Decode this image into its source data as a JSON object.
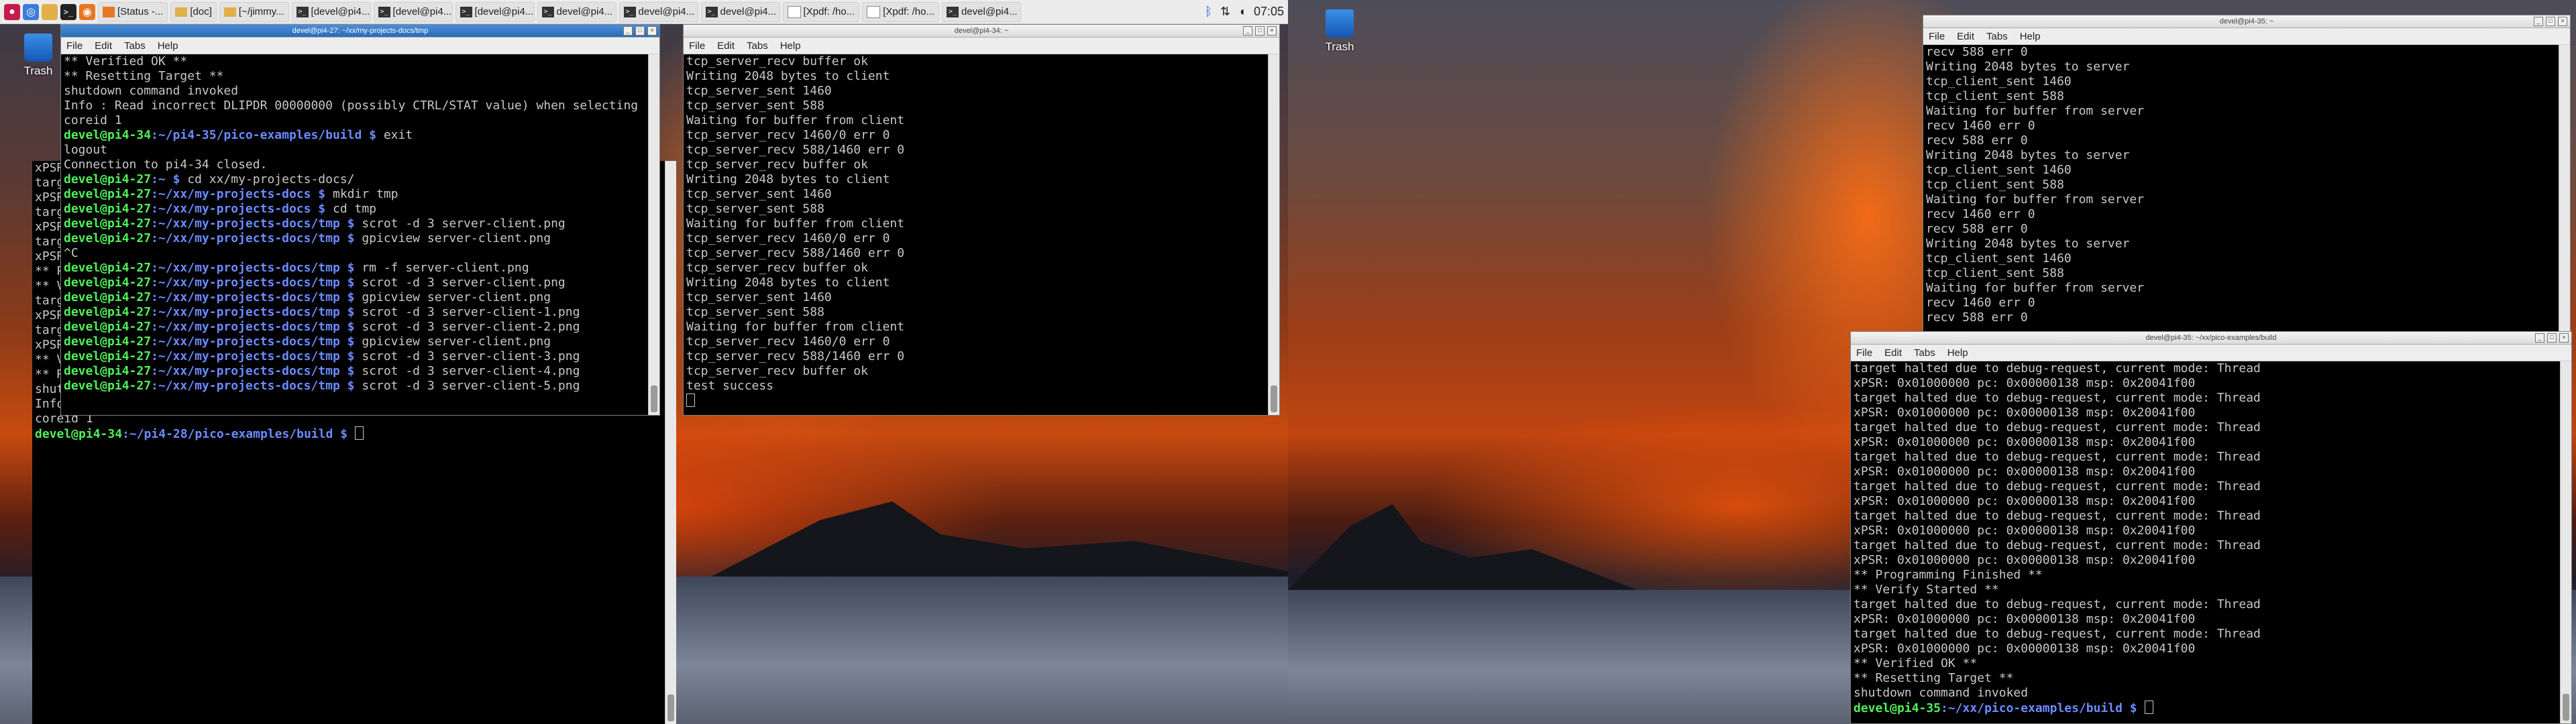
{
  "taskbar": {
    "buttons": [
      {
        "label": "[Status -...",
        "kind": "browser"
      },
      {
        "label": "[doc]",
        "kind": "folder"
      },
      {
        "label": "[~/jimmy...",
        "kind": "folder"
      },
      {
        "label": "[devel@pi4...",
        "kind": "terminal"
      },
      {
        "label": "[devel@pi4...",
        "kind": "terminal"
      },
      {
        "label": "[devel@pi4...",
        "kind": "terminal"
      },
      {
        "label": "devel@pi4...",
        "kind": "terminal"
      },
      {
        "label": "devel@pi4...",
        "kind": "terminal"
      },
      {
        "label": "devel@pi4...",
        "kind": "terminal"
      },
      {
        "label": "[Xpdf: /ho...",
        "kind": "pdf"
      },
      {
        "label": "[Xpdf: /ho...",
        "kind": "pdf"
      },
      {
        "label": "devel@pi4...",
        "kind": "terminal"
      }
    ],
    "clock": "07:05",
    "tray_icons": [
      "bluetooth-icon",
      "network-icon",
      "volume-icon"
    ]
  },
  "desktop": {
    "trash_label": "Trash"
  },
  "menu": {
    "file": "File",
    "edit": "Edit",
    "tabs": "Tabs",
    "help": "Help"
  },
  "windows": {
    "w1": {
      "title": "devel@pi4-27: ~/xx/my-projects-docs/tmp",
      "lines": [
        {
          "t": "** Verified OK **"
        },
        {
          "t": "** Resetting Target **"
        },
        {
          "t": "shutdown command invoked"
        },
        {
          "t": "Info : Read incorrect DLIPDR 00000000 (possibly CTRL/STAT value) when selecting"
        },
        {
          "t": "coreid 1"
        },
        {
          "u": "devel@pi4-34",
          "p": ":~/pi4-35/pico-examples/build $",
          "c": " exit"
        },
        {
          "t": "logout"
        },
        {
          "t": "Connection to pi4-34 closed."
        },
        {
          "u": "devel@pi4-27",
          "p": ":~ $",
          "c": " cd xx/my-projects-docs/"
        },
        {
          "u": "devel@pi4-27",
          "p": ":~/xx/my-projects-docs $",
          "c": " mkdir tmp"
        },
        {
          "u": "devel@pi4-27",
          "p": ":~/xx/my-projects-docs $",
          "c": " cd tmp"
        },
        {
          "u": "devel@pi4-27",
          "p": ":~/xx/my-projects-docs/tmp $",
          "c": " scrot -d 3 server-client.png"
        },
        {
          "u": "devel@pi4-27",
          "p": ":~/xx/my-projects-docs/tmp $",
          "c": " gpicview server-client.png"
        },
        {
          "t": "^C"
        },
        {
          "u": "devel@pi4-27",
          "p": ":~/xx/my-projects-docs/tmp $",
          "c": " rm -f server-client.png"
        },
        {
          "u": "devel@pi4-27",
          "p": ":~/xx/my-projects-docs/tmp $",
          "c": " scrot -d 3 server-client.png"
        },
        {
          "u": "devel@pi4-27",
          "p": ":~/xx/my-projects-docs/tmp $",
          "c": " gpicview server-client.png"
        },
        {
          "u": "devel@pi4-27",
          "p": ":~/xx/my-projects-docs/tmp $",
          "c": " scrot -d 3 server-client-1.png"
        },
        {
          "u": "devel@pi4-27",
          "p": ":~/xx/my-projects-docs/tmp $",
          "c": " scrot -d 3 server-client-2.png"
        },
        {
          "u": "devel@pi4-27",
          "p": ":~/xx/my-projects-docs/tmp $",
          "c": " gpicview server-client.png"
        },
        {
          "u": "devel@pi4-27",
          "p": ":~/xx/my-projects-docs/tmp $",
          "c": " scrot -d 3 server-client-3.png"
        },
        {
          "u": "devel@pi4-27",
          "p": ":~/xx/my-projects-docs/tmp $",
          "c": " scrot -d 3 server-client-4.png"
        },
        {
          "u": "devel@pi4-27",
          "p": ":~/xx/my-projects-docs/tmp $",
          "c": " scrot -d 3 server-client-5.png"
        }
      ]
    },
    "w2": {
      "title": "",
      "lines": [
        {
          "t": "xPSR: 0x01000000 pc: 0x00000138 msp: 0x20041f00"
        },
        {
          "t": "target halted due to debug-request, current mode: Thread"
        },
        {
          "t": "xPSR: 0x01000000 pc: 0x00000138 msp: 0x20041f00"
        },
        {
          "t": "target halted due to debug-request, current mode: Thread"
        },
        {
          "t": "xPSR: 0x01000000 pc: 0x00000138 msp: 0x20041f00"
        },
        {
          "t": "target halted due to debug-request, current mode: Thread"
        },
        {
          "t": "xPSR: 0x01000000 pc: 0x00000138 msp: 0x20041f00"
        },
        {
          "t": "** Programming Finished **"
        },
        {
          "t": "** Verify Started **"
        },
        {
          "t": "target halted due to debug-request, current mode: Thread"
        },
        {
          "t": "xPSR: 0x01000000 pc: 0x00000138 msp: 0x20041f00"
        },
        {
          "t": "target halted due to debug-request, current mode: Thread"
        },
        {
          "t": "xPSR: 0x01000000 pc: 0x00000138 msp: 0x20041f00"
        },
        {
          "t": "** Verified OK **"
        },
        {
          "t": "** Resetting Target **"
        },
        {
          "t": "shutdown command invoked"
        },
        {
          "t": "Info : Read incorrect DLIPDR 00000000 (possibly CTRL/STAT value) when selecting"
        },
        {
          "t": "coreid 1"
        },
        {
          "u": "devel@pi4-34",
          "p": ":~/pi4-28/pico-examples/build $",
          "c": " ",
          "cursor": true
        }
      ]
    },
    "w3": {
      "title": "devel@pi4-34: ~",
      "lines": [
        {
          "t": "tcp_server_recv buffer ok"
        },
        {
          "t": "Writing 2048 bytes to client"
        },
        {
          "t": "tcp_server_sent 1460"
        },
        {
          "t": "tcp_server_sent 588"
        },
        {
          "t": "Waiting for buffer from client"
        },
        {
          "t": "tcp_server_recv 1460/0 err 0"
        },
        {
          "t": "tcp_server_recv 588/1460 err 0"
        },
        {
          "t": "tcp_server_recv buffer ok"
        },
        {
          "t": "Writing 2048 bytes to client"
        },
        {
          "t": "tcp_server_sent 1460"
        },
        {
          "t": "tcp_server_sent 588"
        },
        {
          "t": "Waiting for buffer from client"
        },
        {
          "t": "tcp_server_recv 1460/0 err 0"
        },
        {
          "t": "tcp_server_recv 588/1460 err 0"
        },
        {
          "t": "tcp_server_recv buffer ok"
        },
        {
          "t": "Writing 2048 bytes to client"
        },
        {
          "t": "tcp_server_sent 1460"
        },
        {
          "t": "tcp_server_sent 588"
        },
        {
          "t": "Waiting for buffer from client"
        },
        {
          "t": "tcp_server_recv 1460/0 err 0"
        },
        {
          "t": "tcp_server_recv 588/1460 err 0"
        },
        {
          "t": "tcp_server_recv buffer ok"
        },
        {
          "t": "test success"
        },
        {
          "t": "",
          "cursor": true
        }
      ]
    },
    "w4": {
      "title": "devel@pi4-35: ~",
      "lines": [
        {
          "t": "recv 588 err 0"
        },
        {
          "t": "Writing 2048 bytes to server"
        },
        {
          "t": "tcp_client_sent 1460"
        },
        {
          "t": "tcp_client_sent 588"
        },
        {
          "t": "Waiting for buffer from server"
        },
        {
          "t": "recv 1460 err 0"
        },
        {
          "t": "recv 588 err 0"
        },
        {
          "t": "Writing 2048 bytes to server"
        },
        {
          "t": "tcp_client_sent 1460"
        },
        {
          "t": "tcp_client_sent 588"
        },
        {
          "t": "Waiting for buffer from server"
        },
        {
          "t": "recv 1460 err 0"
        },
        {
          "t": "recv 588 err 0"
        },
        {
          "t": "Writing 2048 bytes to server"
        },
        {
          "t": "tcp_client_sent 1460"
        },
        {
          "t": "tcp_client_sent 588"
        },
        {
          "t": "Waiting for buffer from server"
        },
        {
          "t": "recv 1460 err 0"
        },
        {
          "t": "recv 588 err 0"
        }
      ]
    },
    "w5": {
      "title": "devel@pi4-35: ~/xx/pico-examples/build",
      "lines": [
        {
          "t": "target halted due to debug-request, current mode: Thread"
        },
        {
          "t": "xPSR: 0x01000000 pc: 0x00000138 msp: 0x20041f00"
        },
        {
          "t": "target halted due to debug-request, current mode: Thread"
        },
        {
          "t": "xPSR: 0x01000000 pc: 0x00000138 msp: 0x20041f00"
        },
        {
          "t": "target halted due to debug-request, current mode: Thread"
        },
        {
          "t": "xPSR: 0x01000000 pc: 0x00000138 msp: 0x20041f00"
        },
        {
          "t": "target halted due to debug-request, current mode: Thread"
        },
        {
          "t": "xPSR: 0x01000000 pc: 0x00000138 msp: 0x20041f00"
        },
        {
          "t": "target halted due to debug-request, current mode: Thread"
        },
        {
          "t": "xPSR: 0x01000000 pc: 0x00000138 msp: 0x20041f00"
        },
        {
          "t": "target halted due to debug-request, current mode: Thread"
        },
        {
          "t": "xPSR: 0x01000000 pc: 0x00000138 msp: 0x20041f00"
        },
        {
          "t": "target halted due to debug-request, current mode: Thread"
        },
        {
          "t": "xPSR: 0x01000000 pc: 0x00000138 msp: 0x20041f00"
        },
        {
          "t": "** Programming Finished **"
        },
        {
          "t": "** Verify Started **"
        },
        {
          "t": "target halted due to debug-request, current mode: Thread"
        },
        {
          "t": "xPSR: 0x01000000 pc: 0x00000138 msp: 0x20041f00"
        },
        {
          "t": "target halted due to debug-request, current mode: Thread"
        },
        {
          "t": "xPSR: 0x01000000 pc: 0x00000138 msp: 0x20041f00"
        },
        {
          "t": "** Verified OK **"
        },
        {
          "t": "** Resetting Target **"
        },
        {
          "t": "shutdown command invoked"
        },
        {
          "u": "devel@pi4-35",
          "p": ":~/xx/pico-examples/build $",
          "c": " ",
          "cursor": true
        }
      ]
    }
  }
}
